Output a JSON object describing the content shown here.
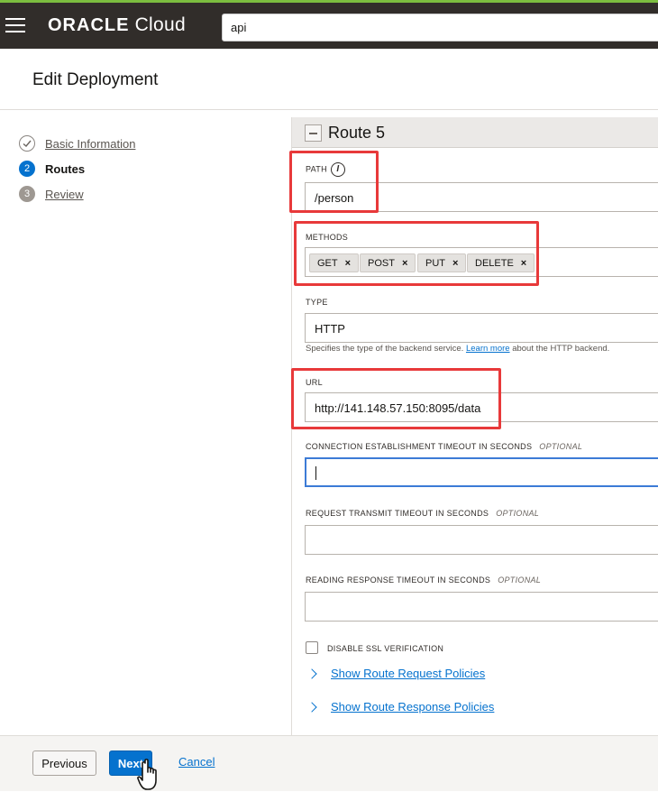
{
  "topbar": {
    "logo_brand": "ORACLE",
    "logo_product": " Cloud",
    "search_value": "api"
  },
  "page": {
    "title": "Edit Deployment"
  },
  "steps": [
    {
      "number": "",
      "label": "Basic Information",
      "state": "done"
    },
    {
      "number": "2",
      "label": "Routes",
      "state": "current"
    },
    {
      "number": "3",
      "label": "Review",
      "state": "todo"
    }
  ],
  "route": {
    "title": "Route 5",
    "path": {
      "label": "PATH",
      "info_icon": "i",
      "value": "/person"
    },
    "methods": {
      "label": "METHODS",
      "items": [
        "GET",
        "POST",
        "PUT",
        "DELETE"
      ],
      "remove_glyph": "×"
    },
    "type": {
      "label": "TYPE",
      "value": "HTTP",
      "help_before": "Specifies the type of the backend service. ",
      "help_link": "Learn more",
      "help_after": " about the HTTP backend."
    },
    "url": {
      "label": "URL",
      "value": "http://141.148.57.150:8095/data"
    },
    "connect_timeout": {
      "label": "CONNECTION ESTABLISHMENT TIMEOUT IN SECONDS",
      "optional": "OPTIONAL",
      "value": ""
    },
    "transmit_timeout": {
      "label": "REQUEST TRANSMIT TIMEOUT IN SECONDS",
      "optional": "OPTIONAL",
      "value": ""
    },
    "reading_timeout": {
      "label": "READING RESPONSE TIMEOUT IN SECONDS",
      "optional": "OPTIONAL",
      "value": ""
    },
    "disable_ssl": {
      "label": "DISABLE SSL VERIFICATION",
      "checked": false
    },
    "request_policies_link": "Show Route Request Policies",
    "response_policies_link": "Show Route Response Policies"
  },
  "footer": {
    "previous_label": "Previous",
    "next_label": "Next",
    "cancel_label": "Cancel"
  },
  "colors": {
    "accent": "#0572ce",
    "topbar": "#312d2a",
    "highlight": "#e8393a"
  }
}
